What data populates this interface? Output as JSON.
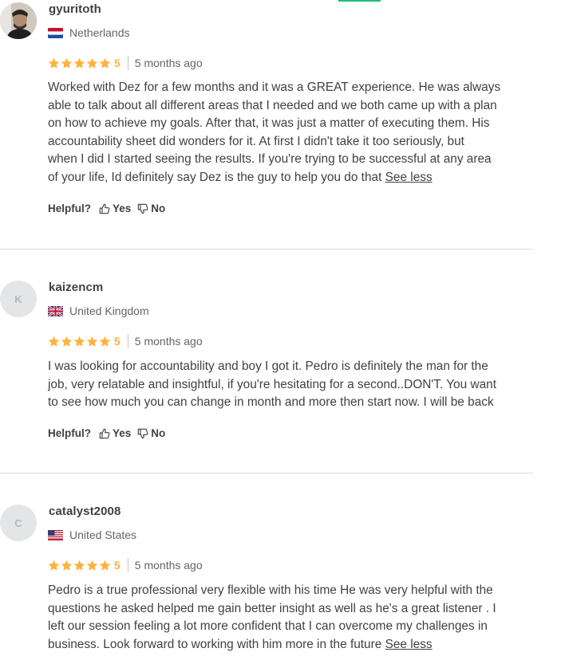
{
  "colors": {
    "star": "#ffb33e",
    "divider": "#dadbdd",
    "accent": "#1dbf73",
    "text": "#404145",
    "muted": "#62646a"
  },
  "reviews": [
    {
      "username": "gyuritoth",
      "avatar_letter": "",
      "country": "Netherlands",
      "flag": "netherlands-flag",
      "rating": "5",
      "stars": 5,
      "time": "5 months ago",
      "lines": [
        "Worked with Dez for a few months and it was a GREAT experience. He was always",
        "able to talk about all different areas that I needed and we both came up with a plan",
        "on how to achieve my goals. After that, it was just a matter of executing them. His",
        "accountability sheet did wonders for it. At first I didn't take it too seriously, but",
        "when I did I started seeing the results. If you're trying to be successful at any area",
        "of your life, Id definitely say Dez is the guy to help you do that"
      ],
      "see_less": "See less",
      "helpful_label": "Helpful?",
      "yes_label": "Yes",
      "no_label": "No"
    },
    {
      "username": "kaizencm",
      "avatar_letter": "K",
      "country": "United Kingdom",
      "flag": "uk-flag",
      "rating": "5",
      "stars": 5,
      "time": "5 months ago",
      "lines": [
        "I was looking for accountability and boy I got it. Pedro is definitely the man for the",
        "job, very relatable and insightful, if you're hesitating for a second..DON'T. You want",
        "to see how much you can change in month and more then start now. I will be back"
      ],
      "see_less": "",
      "helpful_label": "Helpful?",
      "yes_label": "Yes",
      "no_label": "No"
    },
    {
      "username": "catalyst2008",
      "avatar_letter": "C",
      "country": "United States",
      "flag": "us-flag",
      "rating": "5",
      "stars": 5,
      "time": "5 months ago",
      "lines": [
        "Pedro is a true professional very flexible with his time He was very helpful with the",
        "questions he asked helped me gain better insight as well as he's a great listener . I",
        "left our session feeling a lot more confident that I can overcome my challenges in",
        "business. Look forward to working with him more in the future"
      ],
      "see_less": "See less",
      "helpful_label": "",
      "yes_label": "",
      "no_label": ""
    }
  ]
}
